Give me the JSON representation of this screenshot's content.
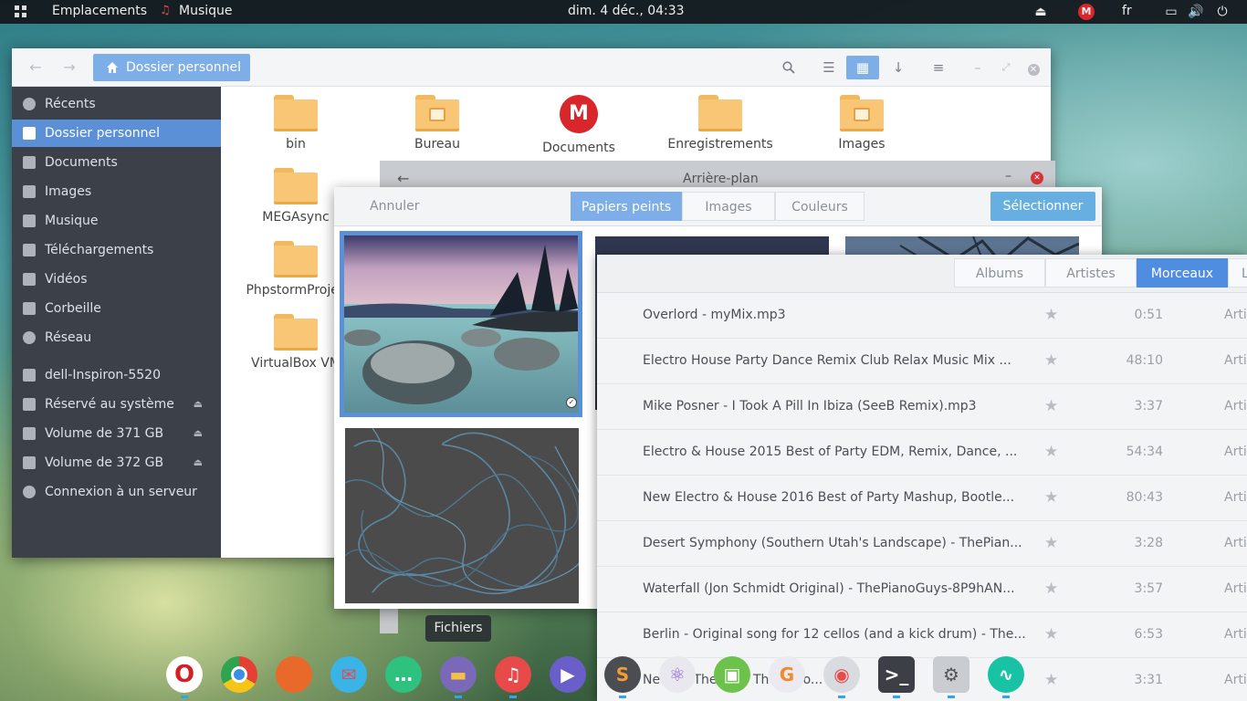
{
  "topbar": {
    "places": "Emplacements",
    "app": "Musique",
    "clock": "dim.  4 déc., 04:33",
    "lang": "fr",
    "mega_badge": "M"
  },
  "files": {
    "breadcrumb": "Dossier personnel",
    "sidebar": [
      {
        "label": "Récents",
        "icon": "clock-icon"
      },
      {
        "label": "Dossier personnel",
        "icon": "home-icon",
        "selected": true
      },
      {
        "label": "Documents",
        "icon": "document-icon"
      },
      {
        "label": "Images",
        "icon": "image-icon"
      },
      {
        "label": "Musique",
        "icon": "music-icon"
      },
      {
        "label": "Téléchargements",
        "icon": "download-icon"
      },
      {
        "label": "Vidéos",
        "icon": "video-icon"
      },
      {
        "label": "Corbeille",
        "icon": "trash-icon"
      },
      {
        "label": "Réseau",
        "icon": "network-icon"
      },
      {
        "label": "dell-Inspiron-5520",
        "icon": "drive-icon"
      },
      {
        "label": "Réservé au système",
        "icon": "usb-icon",
        "eject": true
      },
      {
        "label": "Volume de 371 GB",
        "icon": "usb-icon",
        "eject": true
      },
      {
        "label": "Volume de 372 GB",
        "icon": "usb-icon",
        "eject": true
      },
      {
        "label": "Connexion à un serveur",
        "icon": "network-icon"
      }
    ],
    "items": [
      "bin",
      "Bureau",
      "Documents",
      "Enregistrements",
      "Images",
      "MEGAsync",
      "PhpstormProjec",
      "VirtualBox VM"
    ]
  },
  "background_window": {
    "title": "Arrière-plan",
    "cancel": "Annuler",
    "tabs": [
      "Papiers peints",
      "Images",
      "Couleurs"
    ],
    "select": "Sélectionner"
  },
  "music": {
    "tabs": [
      "Albums",
      "Artistes",
      "Morceaux",
      "L"
    ],
    "tracks": [
      {
        "title": "Overlord - myMix.mp3",
        "duration": "0:51",
        "artist": "Artis"
      },
      {
        "title": "Electro House Party Dance Remix Club Relax Music Mix ...",
        "duration": "48:10",
        "artist": "Artis"
      },
      {
        "title": "Mike Posner - I Took A Pill In Ibiza (SeeB Remix).mp3",
        "duration": "3:37",
        "artist": "Artis"
      },
      {
        "title": "Electro & House 2015 Best of Party EDM, Remix, Dance, ...",
        "duration": "54:34",
        "artist": "Artis"
      },
      {
        "title": "New Electro & House 2016 Best of Party Mashup, Bootle...",
        "duration": "80:43",
        "artist": "Artis"
      },
      {
        "title": "Desert Symphony (Southern Utah's Landscape) - ThePian...",
        "duration": "3:28",
        "artist": "Artis"
      },
      {
        "title": "Waterfall (Jon Schmidt Original) - ThePianoGuys-8P9hAN...",
        "duration": "3:57",
        "artist": "Artis"
      },
      {
        "title": "Berlin - Original song for 12 cellos (and a kick drum) - The...",
        "duration": "6:53",
        "artist": "Artis"
      },
      {
        "title": "Ne      ly G     The     9 c      - Th      oG     go...",
        "duration": "3:31",
        "artist": "Artis"
      }
    ]
  },
  "dock": {
    "tooltip": "Fichiers",
    "apps": [
      {
        "name": "opera-icon",
        "color": "#ffffff",
        "glyph": "O",
        "fg": "#d32027"
      },
      {
        "name": "chrome-icon",
        "color": "#3f8ee6",
        "glyph": "",
        "fg": "#fff"
      },
      {
        "name": "firefox-icon",
        "color": "#e8692a",
        "glyph": "",
        "fg": "#fff"
      },
      {
        "name": "mail-icon",
        "color": "#3ab3e6",
        "glyph": "✉",
        "fg": "#e84a4a"
      },
      {
        "name": "chat-icon",
        "color": "#2ec27e",
        "glyph": "…",
        "fg": "#fff"
      },
      {
        "name": "files-icon",
        "color": "#7a68b8",
        "glyph": "▬",
        "fg": "#f5c144"
      },
      {
        "name": "music-icon",
        "color": "#e84a4a",
        "glyph": "♫",
        "fg": "#fff"
      },
      {
        "name": "video-icon",
        "color": "#6a5fc8",
        "glyph": "▶",
        "fg": "#fff"
      },
      {
        "name": "sublime-icon",
        "color": "#4a4d52",
        "glyph": "S",
        "fg": "#f39c33"
      },
      {
        "name": "atom-icon",
        "color": "#e8e8ee",
        "glyph": "⚛",
        "fg": "#8a5ec8"
      },
      {
        "name": "image-viewer-icon",
        "color": "#6cc24a",
        "glyph": "▣",
        "fg": "#fff"
      },
      {
        "name": "uget-icon",
        "color": "#eaeaf0",
        "glyph": "G",
        "fg": "#f08a2a"
      },
      {
        "name": "toggles-icon",
        "color": "#d8dbe0",
        "glyph": "◉",
        "fg": "#e84a4a"
      },
      {
        "name": "terminal-icon",
        "color": "#3c3f45",
        "glyph": ">_",
        "fg": "#fff"
      },
      {
        "name": "settings-icon",
        "color": "#c9ccd1",
        "glyph": "⚙",
        "fg": "#555"
      },
      {
        "name": "system-monitor-icon",
        "color": "#18c2a4",
        "glyph": "∿",
        "fg": "#fff"
      }
    ]
  }
}
